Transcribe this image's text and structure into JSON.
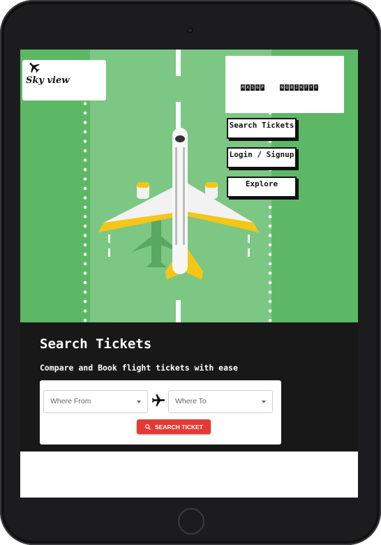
{
  "brand": {
    "name": "Sky view",
    "logo_icon": "plane-icon"
  },
  "flight_board": {
    "departure_caption": "",
    "destination_caption": "",
    "departure_code": [
      "M",
      "X",
      "S",
      "6",
      "P"
    ],
    "destination_code": [
      "N",
      "Q",
      "B",
      "I",
      "K",
      "F",
      "Y",
      "Y"
    ]
  },
  "nav": {
    "search_tickets": "Search Tickets",
    "login_signup": "Login / Signup",
    "explore": "Explore"
  },
  "search": {
    "title": "Search Tickets",
    "subtitle": "Compare and Book flight tickets with ease",
    "from_placeholder": "Where From",
    "to_placeholder": "Where To",
    "button_label": "SEARCH TICKET",
    "button_icon": "search-icon"
  },
  "colors": {
    "hero_green": "#5db866",
    "runway_green": "#7cc784",
    "search_bg": "#181818",
    "button_red": "#e53935",
    "plane_yellow": "#f5c518"
  }
}
